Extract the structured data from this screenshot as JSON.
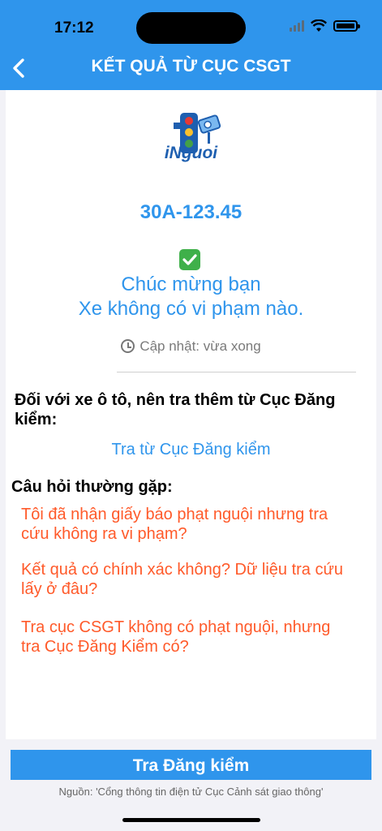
{
  "status_bar": {
    "time": "17:12"
  },
  "header": {
    "title": "KẾT QUẢ TỪ CỤC CSGT"
  },
  "result": {
    "logo_text": "iNguoi",
    "plate": "30A-123.45",
    "congrats_line1": "Chúc mừng bạn",
    "congrats_line2": "Xe không có vi phạm nào.",
    "update_text": "Cập nhật: vừa xong"
  },
  "car_note": {
    "text": "Đối với xe ô tô, nên tra thêm từ Cục Đăng kiểm:",
    "link": "Tra từ Cục Đăng kiểm"
  },
  "faq": {
    "title": "Câu hỏi thường gặp:",
    "items": [
      "Tôi đã nhận giấy báo phạt nguội nhưng tra cứu không ra vi phạm?",
      "Kết quả có chính xác không? Dữ liệu tra cứu lấy ở đâu?",
      "Tra cục CSGT không có phạt nguội, nhưng tra Cục Đăng Kiểm có?"
    ]
  },
  "footer": {
    "button": "Tra Đăng kiểm",
    "source": "Nguồn: 'Cổng thông tin điện tử Cục Cảnh sát giao thông'"
  },
  "colors": {
    "primary": "#2f95ec",
    "faq": "#ff5a2a",
    "success": "#3fb04a"
  },
  "icons": [
    "back-chevron-icon",
    "traffic-light-camera-logo-icon",
    "check-mark-icon",
    "clock-icon",
    "signal-icon",
    "wifi-icon",
    "battery-icon"
  ]
}
